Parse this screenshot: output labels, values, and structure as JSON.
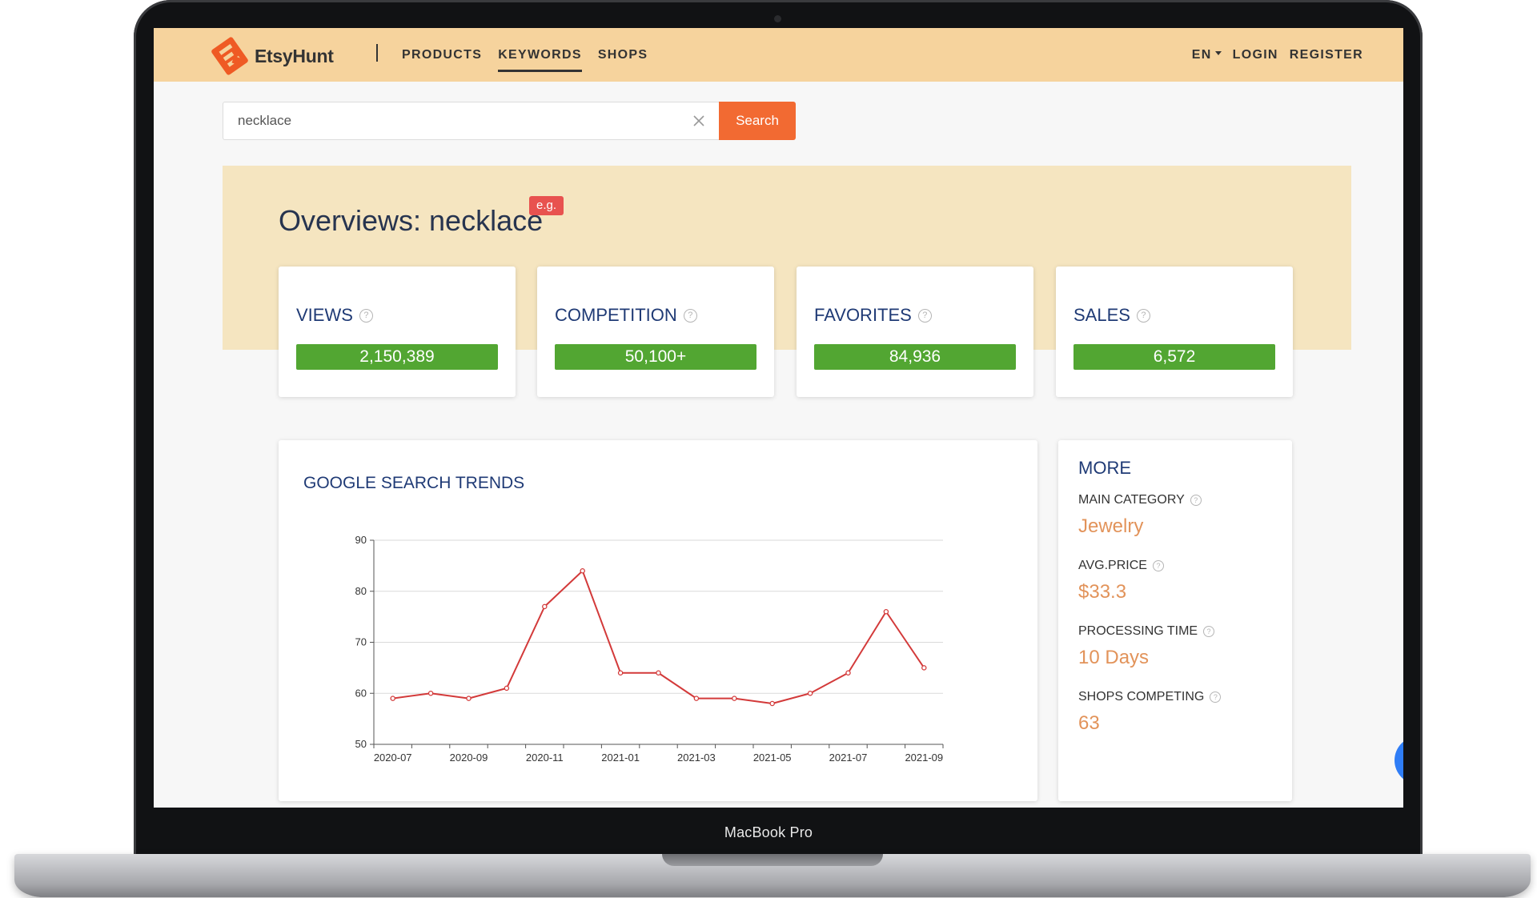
{
  "device": {
    "model_label": "MacBook Pro"
  },
  "nav": {
    "brand": "EtsyHunt",
    "menu": [
      "PRODUCTS",
      "KEYWORDS",
      "SHOPS"
    ],
    "active": "KEYWORDS",
    "language": "EN",
    "login": "LOGIN",
    "register": "REGISTER"
  },
  "search": {
    "value": "necklace",
    "button_label": "Search"
  },
  "overview": {
    "title": "Overviews: necklace",
    "badge": "e.g."
  },
  "stats": [
    {
      "label": "VIEWS",
      "value": "2,150,389"
    },
    {
      "label": "COMPETITION",
      "value": "50,100+"
    },
    {
      "label": "FAVORITES",
      "value": "84,936"
    },
    {
      "label": "SALES",
      "value": "6,572"
    }
  ],
  "trends": {
    "title": "GOOGLE SEARCH TRENDS"
  },
  "more": {
    "title": "MORE",
    "items": [
      {
        "label": "MAIN CATEGORY",
        "value": "Jewelry"
      },
      {
        "label": "AVG.PRICE",
        "value": "$33.3"
      },
      {
        "label": "PROCESSING TIME",
        "value": "10 Days"
      },
      {
        "label": "SHOPS COMPETING",
        "value": "63"
      }
    ]
  },
  "colors": {
    "navbar": "#f6d39d",
    "accent_orange": "#f26a32",
    "stat_green": "#52a632",
    "line_red": "#d33a3a",
    "value_orange": "#e2935a",
    "heading_blue": "#1f3a75",
    "badge_red": "#e8524f"
  },
  "chart_data": {
    "type": "line",
    "title": "GOOGLE SEARCH TRENDS",
    "x": [
      "2020-07",
      "2020-08",
      "2020-09",
      "2020-10",
      "2020-11",
      "2020-12",
      "2021-01",
      "2021-02",
      "2021-03",
      "2021-04",
      "2021-05",
      "2021-06",
      "2021-07",
      "2021-08",
      "2021-09"
    ],
    "x_tick_labels": [
      "2020-07",
      "2020-09",
      "2020-11",
      "2021-01",
      "2021-03",
      "2021-05",
      "2021-07",
      "2021-09"
    ],
    "series": [
      {
        "values": [
          59,
          60,
          59,
          61,
          77,
          84,
          64,
          64,
          59,
          59,
          58,
          60,
          64,
          76,
          65
        ]
      }
    ],
    "ylim": [
      50,
      90
    ],
    "yticks": [
      50,
      60,
      70,
      80,
      90
    ],
    "grid": true
  }
}
